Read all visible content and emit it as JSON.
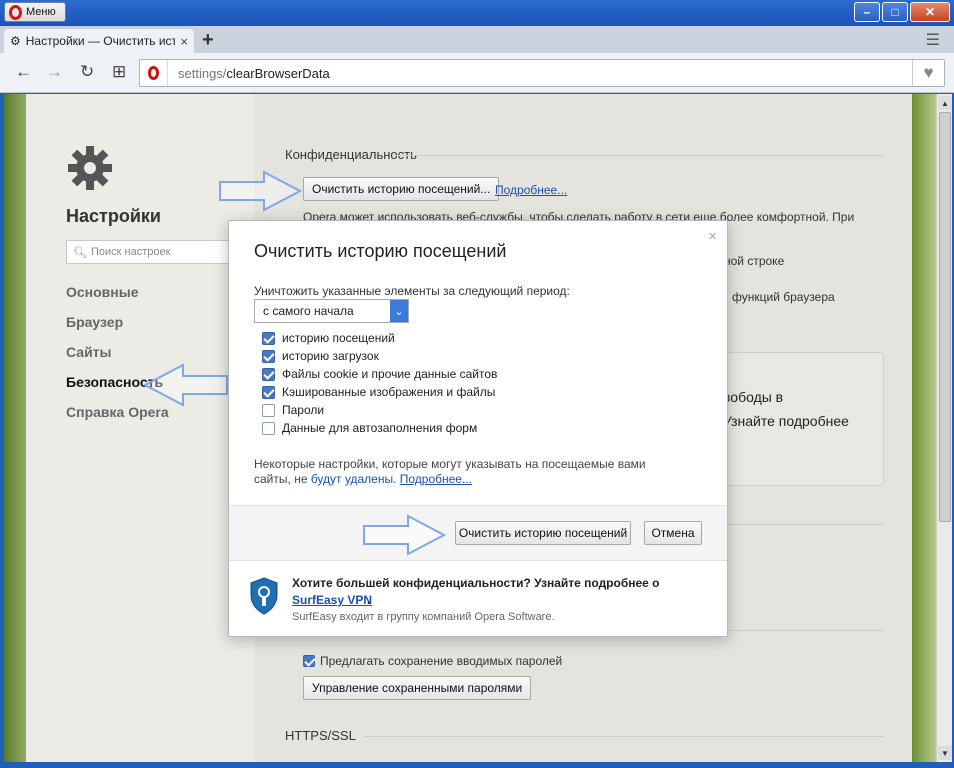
{
  "window": {
    "menu_label": "Меню",
    "minimize": "–",
    "maximize": "□",
    "close": "✕"
  },
  "tabs": {
    "active_title": "Настройки — Очистить ист",
    "close": "×",
    "new_tab": "+"
  },
  "toolbar": {
    "back": "←",
    "forward": "→",
    "reload": "↻",
    "speed_dial": "⊞",
    "url_dim": "settings/",
    "url_path": "clearBrowserData",
    "bookmark": "♥"
  },
  "sidebar": {
    "title": "Настройки",
    "search_placeholder": "Поиск настроек",
    "items": [
      {
        "label": "Основные",
        "active": false
      },
      {
        "label": "Браузер",
        "active": false
      },
      {
        "label": "Сайты",
        "active": false
      },
      {
        "label": "Безопасность",
        "active": true
      },
      {
        "label": "Справка Opera",
        "active": false
      }
    ]
  },
  "main": {
    "section_privacy": "Конфиденциальность",
    "clear_history_button": "Очистить историю посещений...",
    "more_link": "Подробнее...",
    "text_line1": "Opera может использовать веб-службы, чтобы сделать работу в сети еще более комфортной. При",
    "text_line2": "ной строке",
    "text_line3": "функций браузера",
    "box_line1": "вободы в",
    "box_line2": "Узнайте подробнее",
    "offer_passwords": "Предлагать сохранение вводимых паролей",
    "manage_passwords_button": "Управление сохраненными паролями",
    "section_https": "HTTPS/SSL"
  },
  "dialog": {
    "title": "Очистить историю посещений",
    "close": "×",
    "period_label": "Уничтожить указанные элементы за следующий период:",
    "period_value": "с самого начала",
    "options": [
      {
        "label": "историю посещений",
        "checked": true
      },
      {
        "label": "историю загрузок",
        "checked": true
      },
      {
        "label": "Файлы cookie и прочие данные сайтов",
        "checked": true
      },
      {
        "label": "Кэшированные изображения и файлы",
        "checked": true
      },
      {
        "label": "Пароли",
        "checked": false
      },
      {
        "label": "Данные для автозаполнения форм",
        "checked": false
      }
    ],
    "note_text": "Некоторые настройки, которые могут указывать на посещаемые вами сайты,",
    "note_link1": "не будут удалены.",
    "note_link2": "Подробнее...",
    "clear_button": "Очистить историю посещений",
    "cancel_button": "Отмена",
    "promo_heading": "Хотите большей конфиденциальности? Узнайте подробнее о",
    "promo_link": "SurfEasy VPN",
    "promo_dot": ".",
    "promo_sub": "SurfEasy входит в группу компаний Opera Software."
  }
}
